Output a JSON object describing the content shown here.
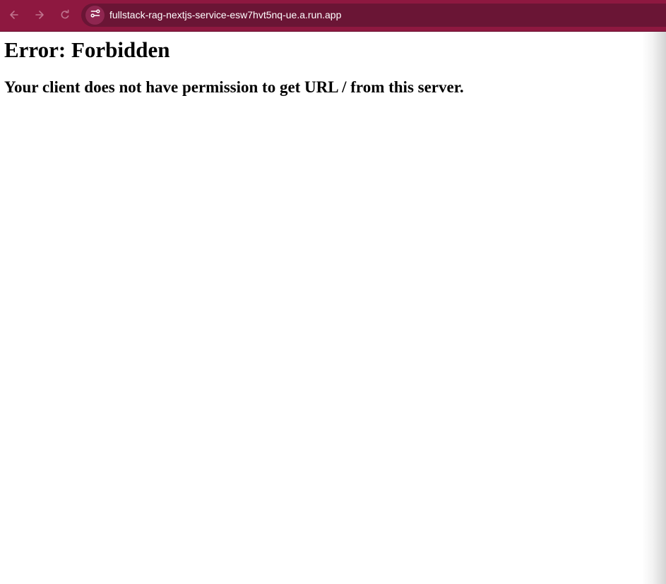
{
  "browser": {
    "toolbar_color": "#8e1840",
    "omnibox_color": "#6a1535",
    "nav": {
      "back_icon": "arrow-left-icon",
      "forward_icon": "arrow-right-icon",
      "reload_icon": "reload-icon"
    },
    "site_info_icon": "tune-icon",
    "url": "fullstack-rag-nextjs-service-esw7hvt5nq-ue.a.run.app"
  },
  "page": {
    "title": "Error: Forbidden",
    "message": "Your client does not have permission to get URL / from this server."
  }
}
